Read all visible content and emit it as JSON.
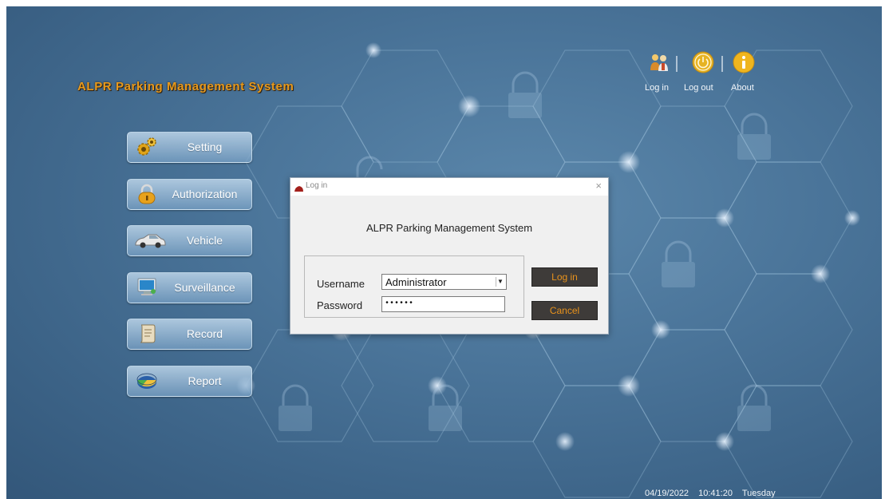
{
  "app": {
    "title": "ALPR Parking Management System"
  },
  "top_actions": [
    {
      "label": "Log in",
      "icon": "users-icon"
    },
    {
      "label": "Log out",
      "icon": "power-icon"
    },
    {
      "label": "About",
      "icon": "info-icon"
    }
  ],
  "menu": [
    {
      "label": "Setting",
      "icon": "gear-icon"
    },
    {
      "label": "Authorization",
      "icon": "padlock-icon"
    },
    {
      "label": "Vehicle",
      "icon": "car-icon"
    },
    {
      "label": "Surveillance",
      "icon": "monitor-icon"
    },
    {
      "label": "Record",
      "icon": "scroll-icon"
    },
    {
      "label": "Report",
      "icon": "pie-chart-icon"
    }
  ],
  "dialog": {
    "title": "Log in",
    "heading": "ALPR Parking Management System",
    "username_label": "Username",
    "username_value": "Administrator",
    "password_label": "Password",
    "password_value": "••••••",
    "login_button": "Log in",
    "cancel_button": "Cancel",
    "close_glyph": "×"
  },
  "status": {
    "date": "04/19/2022",
    "time": "10:41:20",
    "weekday": "Tuesday"
  },
  "colors": {
    "accent": "#e8921c",
    "background": "#4a7499",
    "button_dark": "#3e3b39"
  }
}
